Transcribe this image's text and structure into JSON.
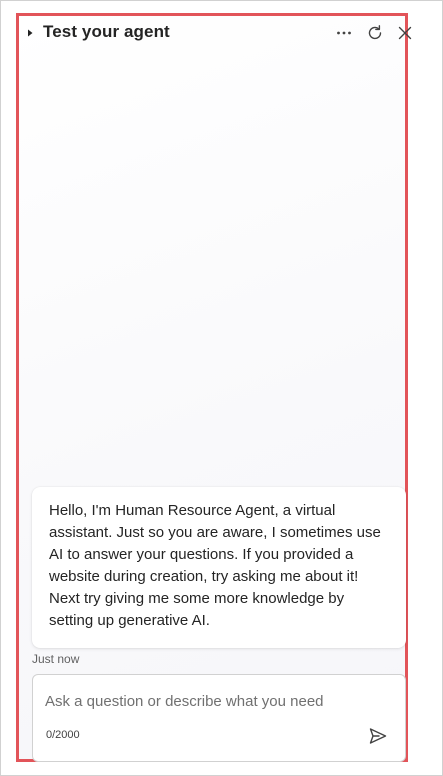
{
  "header": {
    "title": "Test your agent",
    "collapse_icon": "triangle-right-icon",
    "more_icon": "more-horizontal-icon",
    "refresh_icon": "refresh-icon",
    "close_icon": "close-icon"
  },
  "chat": {
    "messages": [
      {
        "text": "Hello, I'm Human Resource Agent, a virtual assistant. Just so you are aware, I sometimes use AI to answer your questions. If you provided a website during creation, try asking me about it! Next try giving me some more knowledge by setting up generative AI.",
        "timestamp": "Just now"
      }
    ]
  },
  "composer": {
    "placeholder": "Ask a question or describe what you need",
    "value": "",
    "char_count": "0/2000",
    "send_icon": "send-icon"
  },
  "colors": {
    "highlight_border": "#e25459",
    "text": "#242424",
    "muted": "#616161"
  }
}
